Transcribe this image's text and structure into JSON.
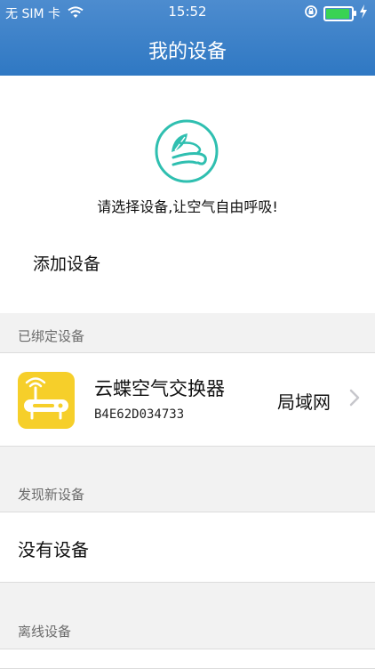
{
  "status": {
    "carrier": "无 SIM 卡",
    "time": "15:52"
  },
  "nav": {
    "title": "我的设备"
  },
  "hero": {
    "slogan": "请选择设备,让空气自由呼吸!",
    "add_device": "添加设备"
  },
  "sections": {
    "bound": "已绑定设备",
    "new": "发现新设备",
    "offline": "离线设备"
  },
  "bound_device": {
    "name": "云蝶空气交换器",
    "id": "B4E62D034733",
    "connection": "局域网"
  },
  "new_devices": {
    "empty_text": "没有设备"
  },
  "colors": {
    "nav": "#2f78c3",
    "accent_teal": "#2fbfb0",
    "router_tile": "#f6cf2a"
  },
  "icons": [
    "wifi-icon",
    "lock-rotation-icon",
    "battery-icon",
    "charging-icon",
    "leaf-icon",
    "router-icon",
    "chevron-right-icon"
  ]
}
